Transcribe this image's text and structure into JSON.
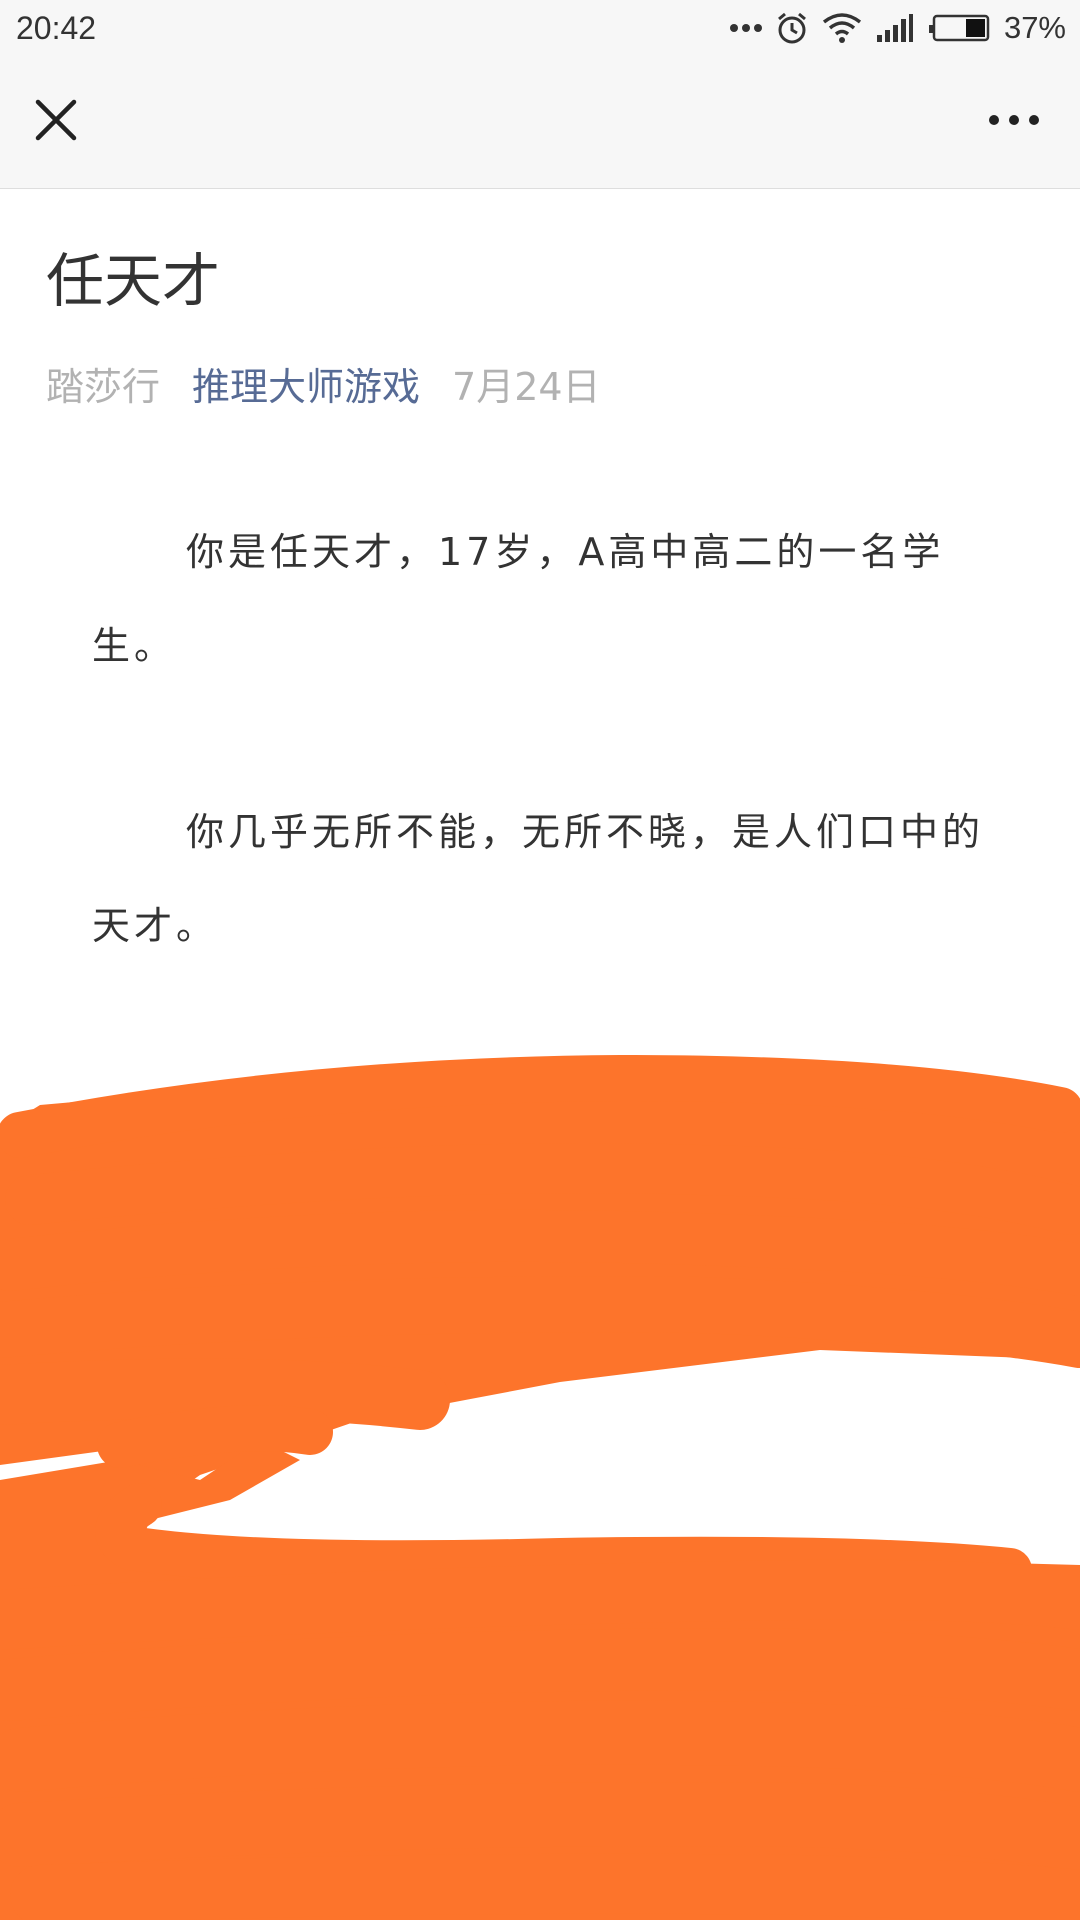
{
  "status_bar": {
    "time": "20:42",
    "battery_percent": "37%",
    "icons": [
      "more-dots-icon",
      "alarm-icon",
      "wifi-icon",
      "signal-icon",
      "battery-icon"
    ]
  },
  "nav": {
    "close_icon": "close-icon",
    "more_icon": "more-icon"
  },
  "article": {
    "title": "任天才",
    "author": "踏莎行",
    "account": "推理大师游戏",
    "date": "7月24日",
    "paragraphs": [
      "你是任天才，17岁，A高中高二的一名学生。",
      "你几乎无所不能，无所不晓，是人们口中的天才。"
    ]
  },
  "colors": {
    "link": "#576b95",
    "meta": "#b2b2b2",
    "text": "#333333",
    "scribble": "#fd742b"
  }
}
